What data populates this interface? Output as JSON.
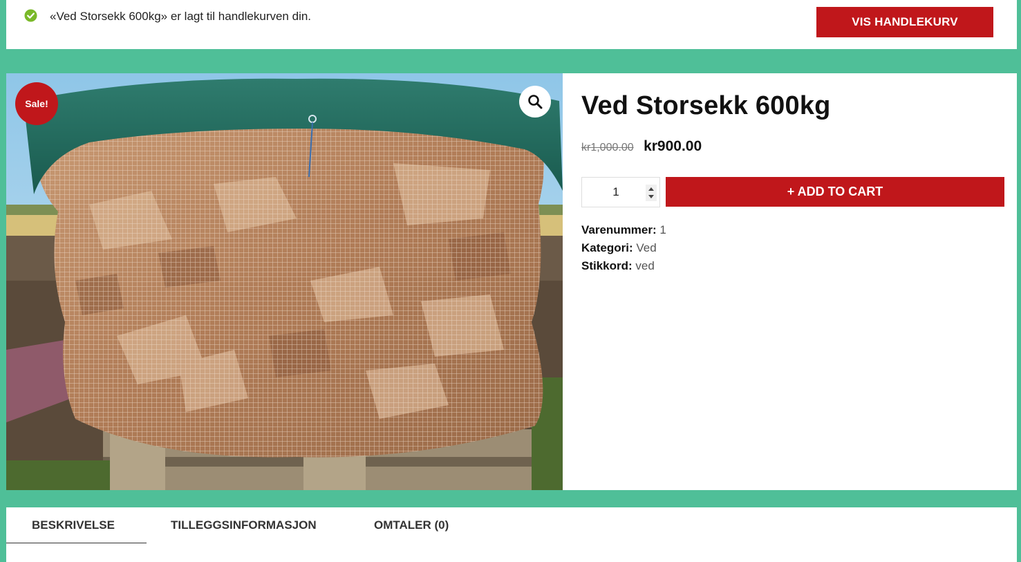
{
  "notice": {
    "message": "«Ved Storsekk 600kg» er lagt til handlekurven din.",
    "view_cart_label": "VIS HANDLEKURV",
    "check_color": "#7ab929"
  },
  "product": {
    "sale_badge": "Sale!",
    "title": "Ved Storsekk 600kg",
    "old_price": "kr1,000.00",
    "price": "kr900.00",
    "quantity": "1",
    "add_to_cart_label": "+ ADD TO CART",
    "meta": {
      "sku_label": "Varenummer:",
      "sku": "1",
      "category_label": "Kategori:",
      "category": "Ved",
      "tags_label": "Stikkord:",
      "tags": "ved"
    }
  },
  "tabs": [
    {
      "label": "BESKRIVELSE",
      "active": true
    },
    {
      "label": "TILLEGGSINFORMASJON",
      "active": false
    },
    {
      "label": "OMTALER (0)",
      "active": false
    }
  ],
  "colors": {
    "accent": "#c0171b",
    "page_background": "#4fbf98"
  }
}
